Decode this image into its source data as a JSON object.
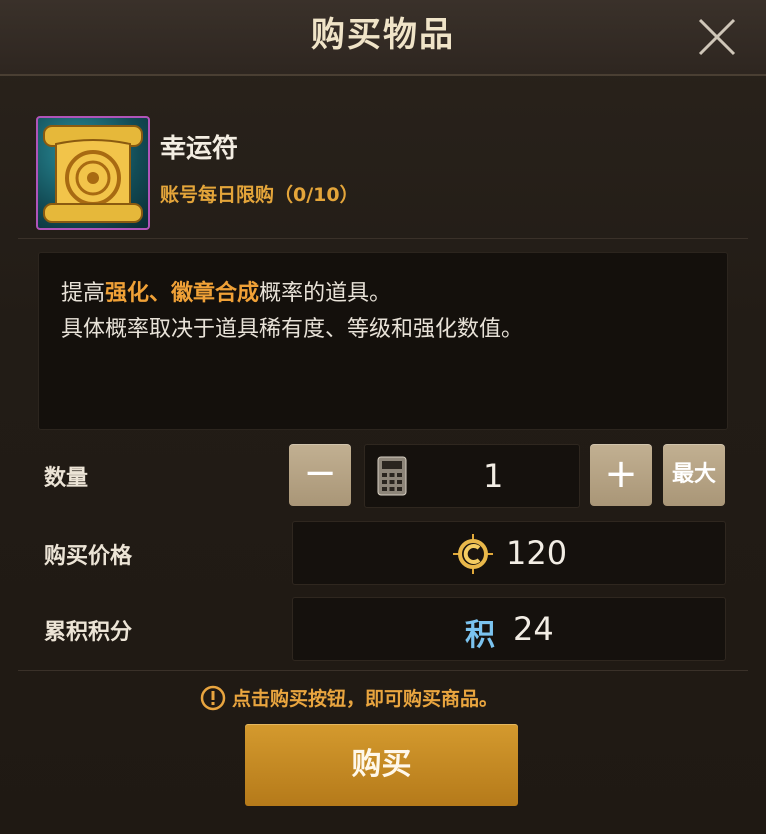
{
  "dialog": {
    "title": "购买物品",
    "close_icon": "close-icon"
  },
  "item": {
    "name": "幸运符",
    "limit_text": "账号每日限购（0/10）",
    "icon": "lucky-charm-scroll-icon",
    "rarity_color": "#b054b9"
  },
  "description": {
    "line1_part1": "提高",
    "line1_hl1": "强化",
    "line1_sep": "、",
    "line1_hl2": "徽章合成",
    "line1_part2": "概率的道具。",
    "line2": "具体概率取决于道具稀有度、等级和强化数值。"
  },
  "quantity": {
    "label": "数量",
    "minus_symbol": "−",
    "plus_symbol": "+",
    "max_label": "最大",
    "value": "1",
    "calculator_icon": "calculator-icon"
  },
  "price": {
    "label": "购买价格",
    "value": "120",
    "currency_icon": "gold-coin-icon"
  },
  "points": {
    "label": "累积积分",
    "icon_char": "积",
    "value": "24"
  },
  "notice": {
    "text": "点击购买按钮，即可购买商品。",
    "icon": "exclamation-circle-icon"
  },
  "buy_button": {
    "label": "购买"
  },
  "colors": {
    "accent_orange": "#e4a53a",
    "buy_button": "#c98d24",
    "step_button": "#b8a584"
  }
}
